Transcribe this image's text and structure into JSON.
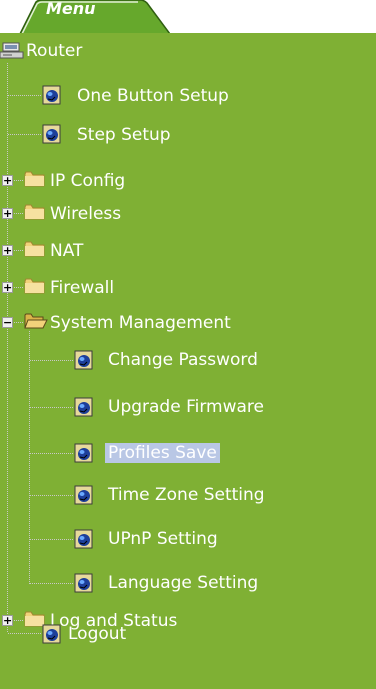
{
  "menu": {
    "title": "Menu"
  },
  "tree": {
    "root": "Router",
    "items": [
      {
        "label": "One Button Setup",
        "type": "page"
      },
      {
        "label": "Step Setup",
        "type": "page"
      },
      {
        "label": "IP Config",
        "type": "folder",
        "state": "collapsed"
      },
      {
        "label": "Wireless",
        "type": "folder",
        "state": "collapsed"
      },
      {
        "label": "NAT",
        "type": "folder",
        "state": "collapsed"
      },
      {
        "label": "Firewall",
        "type": "folder",
        "state": "collapsed"
      },
      {
        "label": "System Management",
        "type": "folder",
        "state": "expanded",
        "children": [
          {
            "label": "Change Password"
          },
          {
            "label": "Upgrade Firmware"
          },
          {
            "label": "Profiles Save",
            "selected": true
          },
          {
            "label": "Time Zone Setting"
          },
          {
            "label": "UPnP Setting"
          },
          {
            "label": "Language Setting"
          }
        ]
      },
      {
        "label": "Log and Status",
        "type": "folder",
        "state": "collapsed"
      },
      {
        "label": "Logout",
        "type": "page"
      }
    ]
  },
  "colors": {
    "panel": "#7fb034",
    "tab": "#66a82c",
    "text": "#ffffff",
    "selected_bg": "#b9c7e5",
    "connector": "#c8c8c8"
  },
  "icons": {
    "root": "computer-icon",
    "page": "globe-page-icon",
    "folder": "folder-icon",
    "folder_open": "open-folder-icon",
    "expander_collapsed": "plus-icon",
    "expander_expanded": "minus-icon"
  }
}
